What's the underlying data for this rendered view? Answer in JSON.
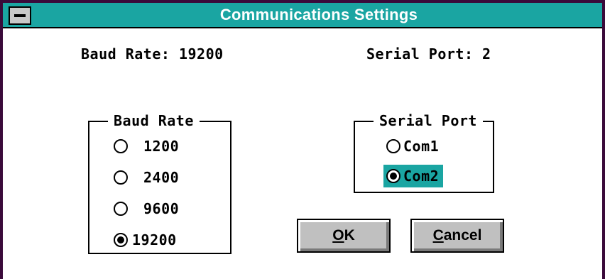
{
  "window": {
    "title": "Communications Settings"
  },
  "status": {
    "baud_rate_label": "Baud Rate:",
    "baud_rate_value": "19200",
    "serial_port_label": "Serial Port:",
    "serial_port_value": "2"
  },
  "baud_group": {
    "label": "Baud Rate",
    "options": [
      "1200",
      "2400",
      "9600",
      "19200"
    ],
    "selected": "19200"
  },
  "port_group": {
    "label": "Serial Port",
    "options": [
      "Com1",
      "Com2"
    ],
    "selected": "Com2"
  },
  "buttons": {
    "ok_accel": "O",
    "ok_rest": "K",
    "cancel_accel": "C",
    "cancel_rest": "ancel"
  },
  "colors": {
    "title_bar": "#1aa5a2",
    "window_frame": "#3a0a3a",
    "button_face": "#c0c0c0",
    "focus_highlight": "#1aa5a2"
  }
}
